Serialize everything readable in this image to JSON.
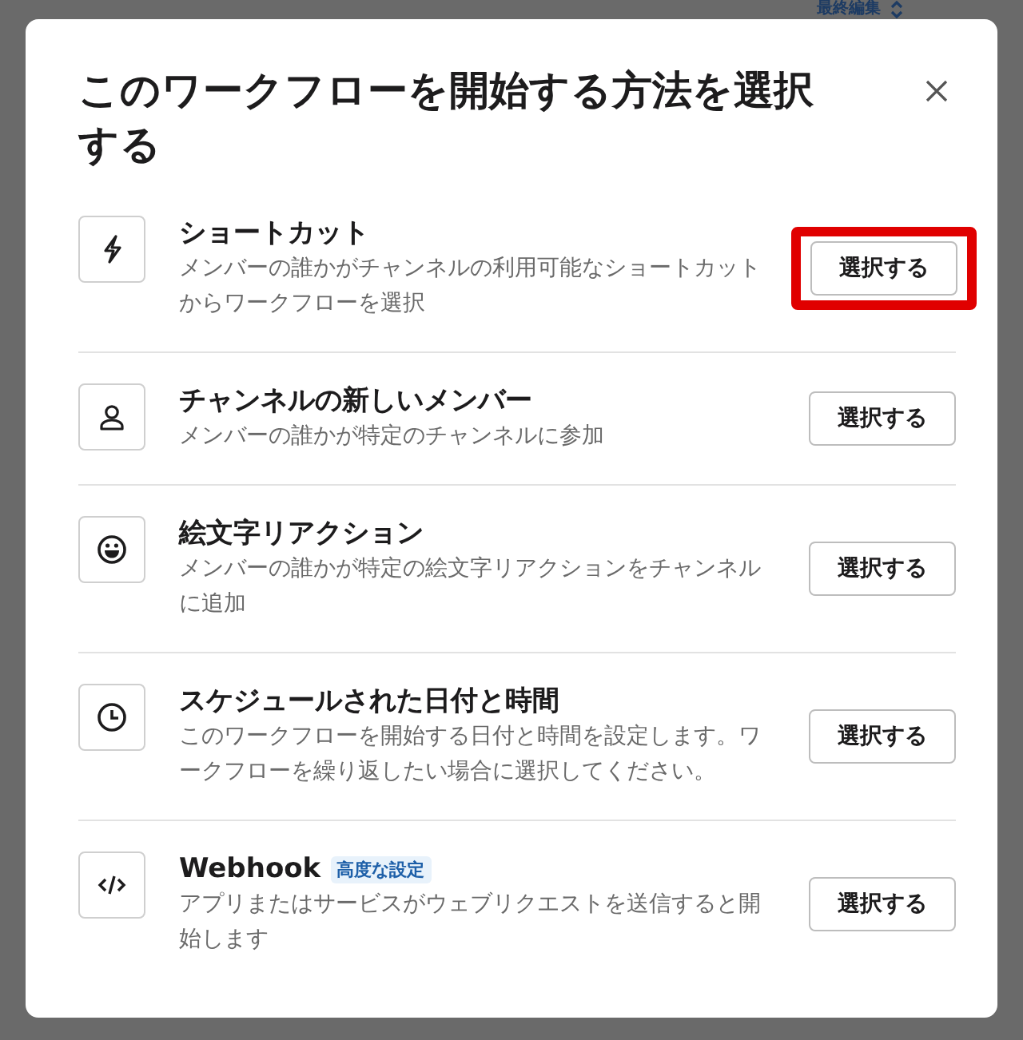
{
  "background": {
    "sort_label": "最終編集"
  },
  "dialog": {
    "title": "このワークフローを開始する方法を選択する",
    "options": [
      {
        "kind": "bolt",
        "title": "ショートカット",
        "description": "メンバーの誰かがチャンネルの利用可能なショートカットからワークフローを選択",
        "button": "選択する",
        "highlighted": true
      },
      {
        "kind": "person",
        "title": "チャンネルの新しいメンバー",
        "description": "メンバーの誰かが特定のチャンネルに参加",
        "button": "選択する",
        "highlighted": false
      },
      {
        "kind": "emoji",
        "title": "絵文字リアクション",
        "description": "メンバーの誰かが特定の絵文字リアクションをチャンネルに追加",
        "button": "選択する",
        "highlighted": false
      },
      {
        "kind": "clock",
        "title": "スケジュールされた日付と時間",
        "description": "このワークフローを開始する日付と時間を設定します。ワークフローを繰り返したい場合に選択してください。",
        "button": "選択する",
        "highlighted": false
      },
      {
        "kind": "code",
        "title": "Webhook",
        "badge": "高度な設定",
        "description": "アプリまたはサービスがウェブリクエストを送信すると開始します",
        "button": "選択する",
        "highlighted": false
      }
    ]
  }
}
